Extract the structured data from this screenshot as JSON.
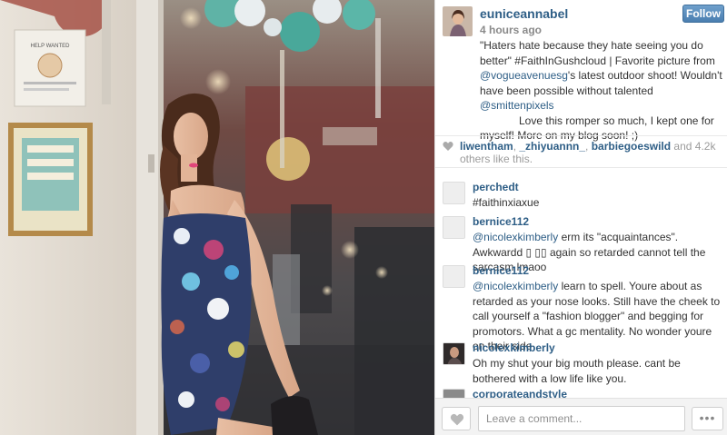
{
  "post": {
    "username": "euniceannabel",
    "time": "4 hours ago",
    "follow_label": "Follow",
    "caption": {
      "line1": "\"Haters hate because they hate seeing you do better\" #FaithInGushcloud | Favorite picture from",
      "mention1": "@vogueavenuesg",
      "line2": "'s latest outdoor shoot! Wouldn't have been possible without talented",
      "mention2": "@smittenpixels",
      "line3": "Love this romper so much, I kept one for myself! More on my blog soon! ;)"
    }
  },
  "likes": {
    "users": [
      "liwentham",
      "_zhiyuannn_",
      "barbiegoeswild"
    ],
    "sep": ", ",
    "suffix": "and 4.2k others like this."
  },
  "comments": [
    {
      "user": "perchedt",
      "mention": "",
      "text": "#faithinxiaxue"
    },
    {
      "user": "bernice112",
      "mention": "@nicolexkimberly",
      "text": "erm its \"acquaintances\". Awkwardd ▯ ▯▯ again so retarded cannot tell the sarcasm lmaoo"
    },
    {
      "user": "bernice112",
      "mention": "@nicolexkimberly",
      "text": "learn to spell. Youre about as retarded as your nose looks. Still have the cheek to call yourself a \"fashion blogger\" and begging for promotors. What a gc mentality. No wonder youre on their side"
    },
    {
      "user": "nicolexkimberly",
      "mention": "",
      "text": "Oh my shut your big mouth please. cant be bothered with a low life like you."
    },
    {
      "user": "corporateandstyle",
      "mention": "",
      "text": ""
    }
  ],
  "footer": {
    "comment_placeholder": "Leave a comment...",
    "more_label": "•••"
  },
  "photo": {
    "sign_text": "HELP WANTED"
  },
  "colors": {
    "link": "#2e5e86",
    "follow_button": "#4a7eb0",
    "dress_accent": "#e0467a"
  }
}
